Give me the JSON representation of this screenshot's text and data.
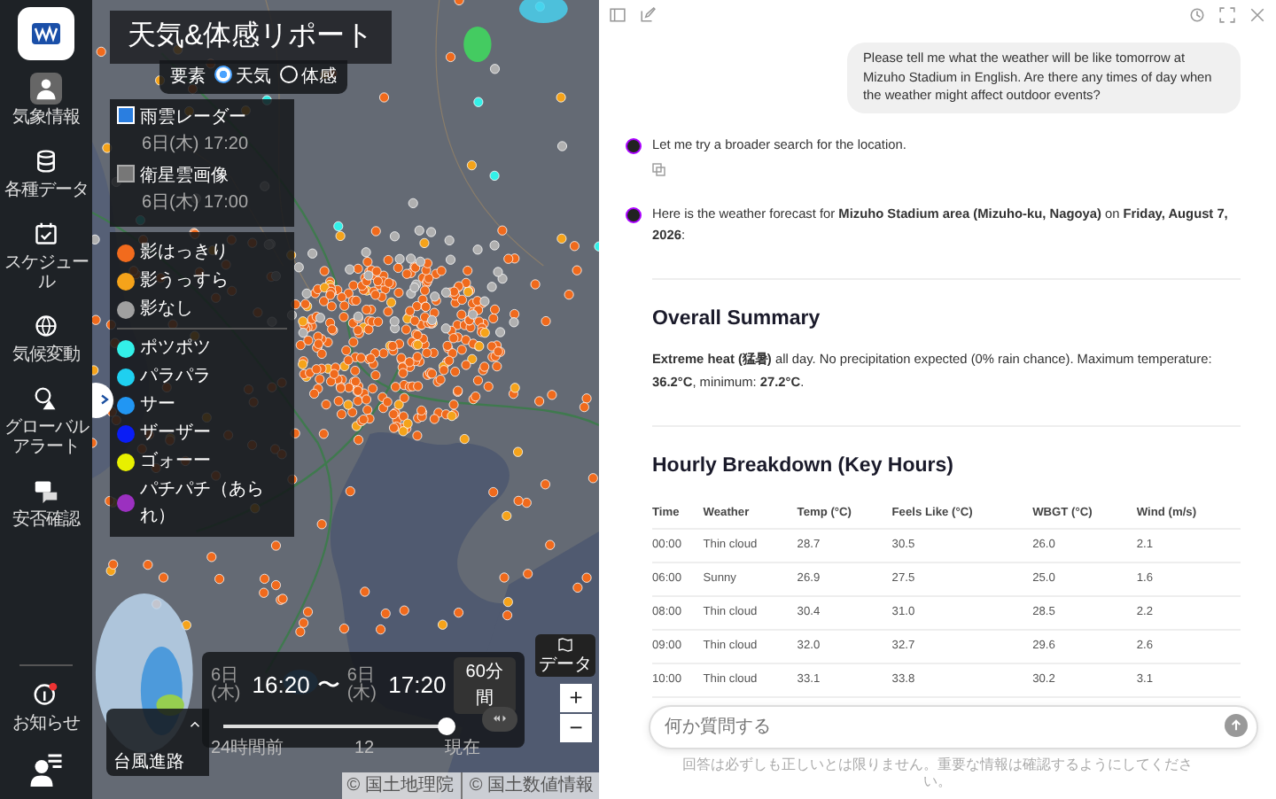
{
  "sidebar": {
    "items": [
      {
        "label": "気象情報",
        "selected": true
      },
      {
        "label": "各種データ",
        "selected": false
      },
      {
        "label": "スケジュール",
        "selected": false
      },
      {
        "label": "気候変動",
        "selected": false
      },
      {
        "label": "グローバルアラート",
        "selected": false
      },
      {
        "label": "安否確認",
        "selected": false
      }
    ],
    "notice": {
      "label": "お知らせ"
    }
  },
  "map": {
    "title": "天気&体感リポート",
    "element_picker": {
      "label": "要素",
      "options": [
        {
          "label": "天気",
          "selected": true
        },
        {
          "label": "体感",
          "selected": false
        }
      ]
    },
    "layers": [
      {
        "label": "雨雲レーダー",
        "time": "6日(木) 17:20",
        "checked": true
      },
      {
        "label": "衛星雲画像",
        "time": "6日(木) 17:00",
        "checked": false
      }
    ],
    "legend": [
      [
        {
          "label": "影はっきり",
          "color": "#f26b1d"
        },
        {
          "label": "影うっすら",
          "color": "#f5a31a"
        },
        {
          "label": "影なし",
          "color": "#a0a0a0"
        }
      ],
      [
        {
          "label": "ポツポツ",
          "color": "#33f0e8"
        },
        {
          "label": "パラパラ",
          "color": "#1fd0f0"
        },
        {
          "label": "サー",
          "color": "#2196f3"
        },
        {
          "label": "ザーザー",
          "color": "#0a1df5"
        },
        {
          "label": "ゴォーー",
          "color": "#e8f000"
        },
        {
          "label": "パチパチ（あられ）",
          "color": "#9b30c0"
        }
      ]
    ],
    "typhoon": {
      "label": "台風進路"
    },
    "timebar": {
      "from_date": "6日(木)",
      "from": "16:20",
      "separator": "〜",
      "to_date": "6日(木)",
      "to": "17:20",
      "span": "60分間",
      "level": 1,
      "ticks": [
        "24時間前",
        "12",
        "現在"
      ]
    },
    "layer_button": "データ",
    "zoom": [
      "+",
      "−"
    ],
    "attribution": [
      "© 国土地理院",
      "© 国土数値情報"
    ]
  },
  "chat": {
    "messages": [
      {
        "kind": "user",
        "text": "Please tell me what the weather will be like tomorrow at Mizuho Stadium in English. Are there any times of day when the weather might affect outdoor events?"
      },
      {
        "kind": "assistant",
        "text": "Let me try a broader search for the location.",
        "copy": true
      },
      {
        "kind": "assistant",
        "text": "Here is the weather forecast for **Mizuho Stadium area (Mizuho-ku, Nagoya)** on **Friday, August 7, 2026**:",
        "copy": false
      }
    ],
    "sections": [
      {
        "heading": "Overall Summary",
        "text": "**Extreme heat (猛暑)** all day. No precipitation expected (0% rain chance). Maximum temperature: **36.2°C**, minimum: **27.2°C**."
      },
      {
        "heading": "Hourly Breakdown (Key Hours)",
        "table": {
          "columns": [
            "Time",
            "Weather",
            "Temp (°C)",
            "Feels Like (°C)",
            "WBGT (°C)",
            "Wind (m/s)"
          ],
          "rows": [
            [
              "00:00",
              "Thin cloud",
              "28.7",
              "30.5",
              "26.0",
              "2.1"
            ],
            [
              "06:00",
              "Sunny",
              "26.9",
              "27.5",
              "25.0",
              "1.6"
            ],
            [
              "08:00",
              "Thin cloud",
              "30.4",
              "31.0",
              "28.5",
              "2.2"
            ],
            [
              "09:00",
              "Thin cloud",
              "32.0",
              "32.7",
              "29.6",
              "2.6"
            ],
            [
              "10:00",
              "Thin cloud",
              "33.1",
              "33.8",
              "30.2",
              "3.1"
            ]
          ]
        }
      }
    ],
    "input": {
      "placeholder": "何か質問する"
    },
    "disclaimer": "回答は必ずしも正しいとは限りません。重要な情報は確認するようにしてください。"
  }
}
